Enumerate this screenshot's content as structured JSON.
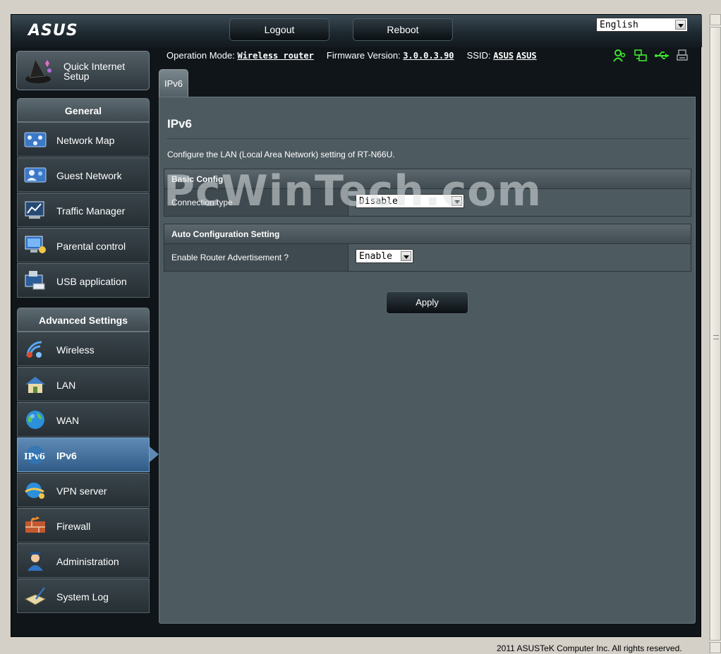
{
  "header": {
    "logo_text": "ASUS",
    "logout_label": "Logout",
    "reboot_label": "Reboot",
    "language": "English"
  },
  "info": {
    "operation_mode_label": "Operation Mode:",
    "operation_mode_value": "Wireless router",
    "firmware_label": "Firmware Version:",
    "firmware_value": "3.0.0.3.90",
    "ssid_label": "SSID:",
    "ssid_1": "ASUS",
    "ssid_2": "ASUS"
  },
  "status_icons": [
    "client-status-icon",
    "network-status-icon",
    "usb-status-icon",
    "printer-status-icon"
  ],
  "colors": {
    "status_green": "#3ee62f",
    "active_item": "#4f7ca6"
  },
  "sidebar": {
    "quick_setup_label": "Quick Internet Setup",
    "general_title": "General",
    "general_items": [
      {
        "label": "Network Map",
        "icon": "network-map-icon"
      },
      {
        "label": "Guest Network",
        "icon": "guest-network-icon"
      },
      {
        "label": "Traffic Manager",
        "icon": "traffic-manager-icon"
      },
      {
        "label": "Parental control",
        "icon": "parental-control-icon"
      },
      {
        "label": "USB application",
        "icon": "usb-application-icon"
      }
    ],
    "advanced_title": "Advanced Settings",
    "advanced_items": [
      {
        "label": "Wireless",
        "icon": "wireless-icon"
      },
      {
        "label": "LAN",
        "icon": "lan-icon"
      },
      {
        "label": "WAN",
        "icon": "wan-icon"
      },
      {
        "label": "IPv6",
        "icon": "ipv6-icon"
      },
      {
        "label": "VPN server",
        "icon": "vpn-server-icon"
      },
      {
        "label": "Firewall",
        "icon": "firewall-icon"
      },
      {
        "label": "Administration",
        "icon": "administration-icon"
      },
      {
        "label": "System Log",
        "icon": "system-log-icon"
      }
    ]
  },
  "tab_label": "IPv6",
  "main": {
    "title": "IPv6",
    "description": "Configure the LAN (Local Area Network) setting of RT-N66U.",
    "basic_config_title": "Basic Config",
    "connection_type_label": "Connection type",
    "connection_type_value": "Disable",
    "auto_config_title": "Auto Configuration Setting",
    "router_adv_label": "Enable Router Advertisement ?",
    "router_adv_value": "Enable",
    "apply_label": "Apply"
  },
  "watermark": "PcWinTech.com",
  "footer": "2011 ASUSTeK Computer Inc. All rights reserved."
}
